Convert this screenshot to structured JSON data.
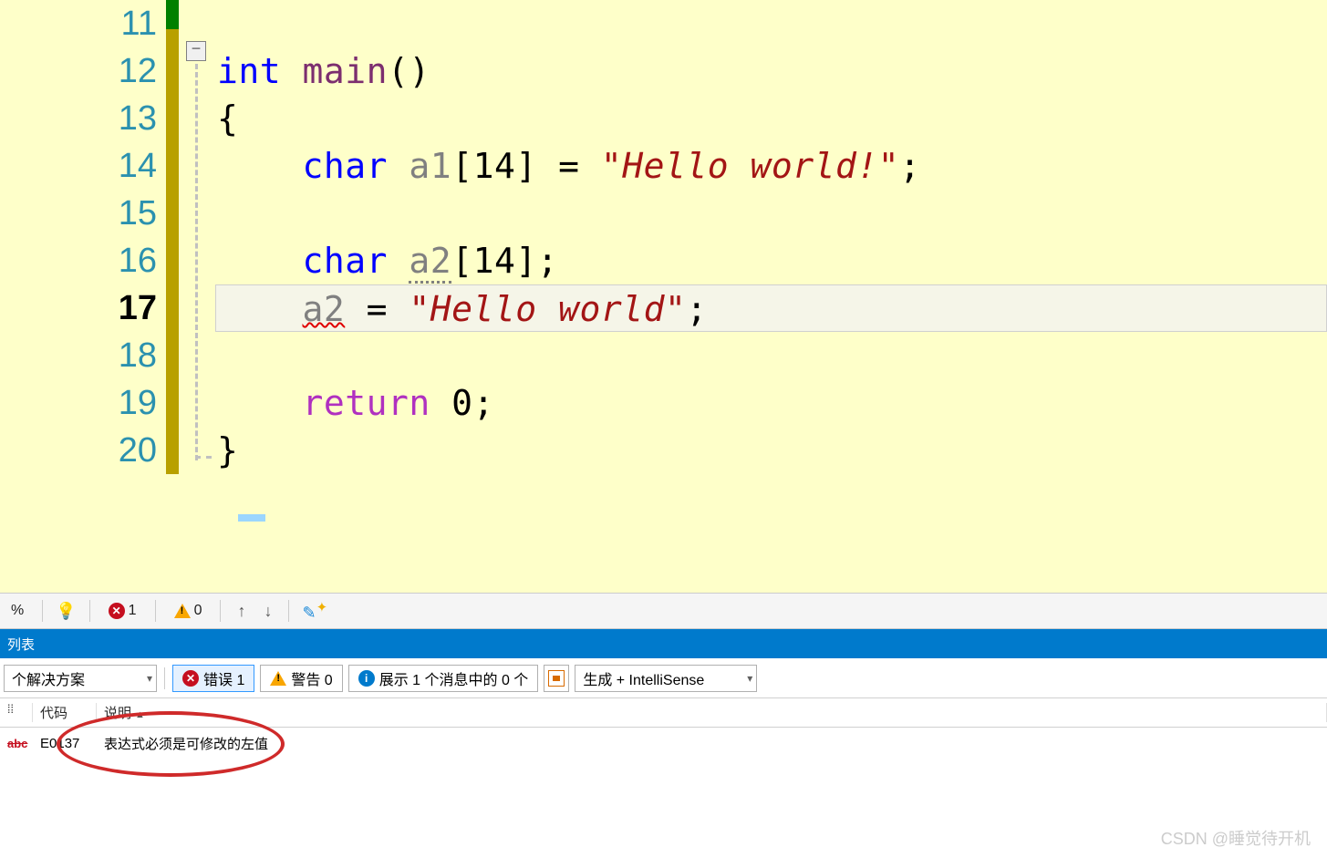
{
  "editor": {
    "lines": [
      "11",
      "12",
      "13",
      "14",
      "15",
      "16",
      "17",
      "18",
      "19",
      "20"
    ],
    "active_line": "17",
    "code": {
      "l12_kw": "int",
      "l12_fn": "main",
      "l12_par": "()",
      "l13": "{",
      "l14_kw": "char",
      "l14_id": "a1",
      "l14_arr": "[14]",
      "l14_eq": " = ",
      "l14_str": "\"Hello world!\"",
      "l14_sc": ";",
      "l16_kw": "char",
      "l16_id": "a2",
      "l16_arr": "[14]",
      "l16_sc": ";",
      "l17_id": "a2",
      "l17_eq": " = ",
      "l17_str": "\"Hello world\"",
      "l17_sc": ";",
      "l19_ret": "return",
      "l19_val": " 0",
      "l19_sc": ";",
      "l20": "}"
    },
    "fold_symbol": "−"
  },
  "toolbar": {
    "pct": "%",
    "err_count": "1",
    "warn_count": "0",
    "arrow_up": "↑",
    "arrow_down": "↓"
  },
  "panel": {
    "title": "列表",
    "solution_combo": "个解决方案",
    "errors_label": "错误 1",
    "warnings_label": "警告 0",
    "messages_label": "展示 1 个消息中的 0 个",
    "build_combo": "生成 + IntelliSense",
    "col_code": "代码",
    "col_desc": "说明",
    "row": {
      "icon_text": "abc",
      "code": "E0137",
      "desc": "表达式必须是可修改的左值"
    }
  },
  "watermark": "CSDN @睡觉待开机"
}
